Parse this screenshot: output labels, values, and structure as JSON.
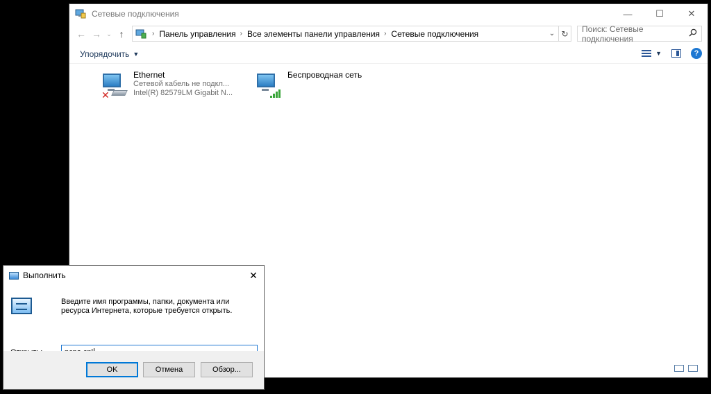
{
  "explorer": {
    "title": "Сетевые подключения",
    "controls": {
      "minimize": "—",
      "maximize": "☐",
      "close": "✕"
    },
    "nav": {
      "back": "←",
      "forward": "→",
      "history": "⌄",
      "up": "↑"
    },
    "breadcrumbs": [
      "Панель управления",
      "Все элементы панели управления",
      "Сетевые подключения"
    ],
    "search_placeholder": "Поиск: Сетевые подключения",
    "organize_label": "Упорядочить",
    "items": [
      {
        "name": "Ethernet",
        "status": "Сетевой кабель не подкл...",
        "device": "Intel(R) 82579LM Gigabit N..."
      },
      {
        "name": "Беспроводная сеть"
      }
    ]
  },
  "run": {
    "title": "Выполнить",
    "close": "✕",
    "description": "Введите имя программы, папки, документа или ресурса Интернета, которые требуется открыть.",
    "open_label_first": "О",
    "open_label_rest": "ткрыть:",
    "command_value": "ncpa.cpl",
    "ok_label": "OK",
    "cancel_label": "Отмена",
    "browse_label": "Обзор..."
  },
  "colors": {
    "accent": "#0078d7",
    "link": "#1e395b",
    "error_red": "#d0201c",
    "signal_green": "#3aa53a"
  }
}
